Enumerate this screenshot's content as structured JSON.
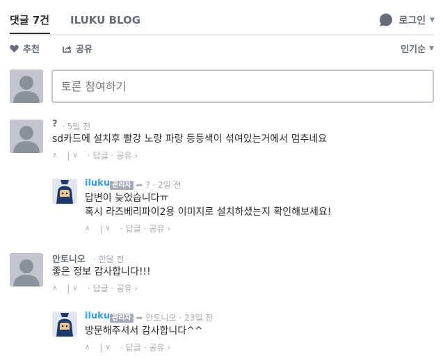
{
  "nav": {
    "tab_comments": "댓글 7건",
    "tab_blog": "ILUKU BLOG",
    "login_label": "로그인"
  },
  "actions": {
    "recommend": "추천",
    "share": "공유",
    "sort": "인기순"
  },
  "compose": {
    "placeholder": "토론 참여하기"
  },
  "comments": [
    {
      "author": "?",
      "time": "5일 전",
      "body": "sd카드에 설치후 빨강 노랑 파랑 등등색이 섞여있는거에서 멈추네요",
      "reply": "답글",
      "share": "공유 ›"
    },
    {
      "author": "iluku",
      "badge": "관리자",
      "reply_to": "?",
      "time": "2일 전",
      "body_line1": "답변이 늦었습니다ㅠ",
      "body_line2": "혹시 라즈베리파이2용 이미지로 설치하셨는지 확인해보세요!",
      "reply": "답글",
      "share": "공유 ›"
    },
    {
      "author": "안토니오",
      "time": "한달 전",
      "body": "좋은 정보 감사합니다!!!",
      "reply": "답글",
      "share": "공유 ›"
    },
    {
      "author": "iluku",
      "badge": "관리자",
      "reply_to": "안토니오",
      "time": "23일 전",
      "body": "방문해주셔서 감사합니다^^",
      "reply": "답글",
      "share": "공유 ›"
    }
  ],
  "colors": {
    "text": "#2a2e2e",
    "muted": "#656c7a",
    "light": "#a5abb2",
    "admin": "#2e9fff",
    "avatar_bg": "#c2c6cc"
  }
}
